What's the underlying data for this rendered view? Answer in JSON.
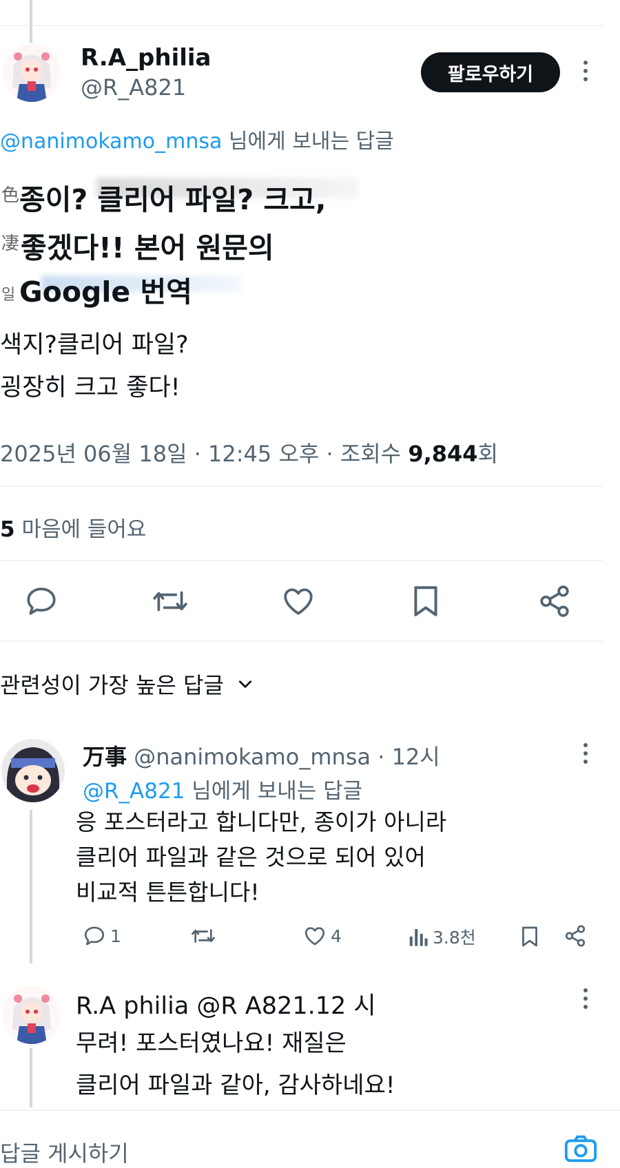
{
  "tweet": {
    "display_name": "R.A_philia",
    "handle": "@R_A821",
    "follow_label": "팔로우하기",
    "reply_to_handle": "@nanimokamo_mnsa",
    "reply_to_suffix": "님에게 보내는 답글",
    "translation_lines": [
      "종이? 클리어 파일? 크고,",
      "좋겠다!! 본어 원문의",
      "Google 번역"
    ],
    "ghost_glyphs": [
      "色",
      "凄",
      "일"
    ],
    "body_lines": [
      "색지?클리어 파일?",
      "굉장히 크고 좋다!"
    ],
    "meta_prefix": "2025년 06월 18일 · 12:45 오후 · 조회수 ",
    "views": "9,844",
    "views_suffix": "회",
    "likes_count": "5",
    "likes_label": "마음에 들어요"
  },
  "replies_sort": {
    "label": "관련성이 가장 높은 답글"
  },
  "reply1": {
    "display_name": "万事",
    "handle_time": "@nanimokamo_mnsa · 12시",
    "reply_to_handle": "@R_A821",
    "reply_to_suffix": "님에게 보내는 답글",
    "lines": [
      "응 포스터라고 합니다만, 종이가 아니라",
      "클리어 파일과 같은 것으로 되어 있어",
      "비교적 튼튼합니다!"
    ],
    "reply_count": "1",
    "like_count": "4",
    "view_count": "3.8천"
  },
  "reply2": {
    "header": "R.A philia @R A821.12 시",
    "lines": [
      "무려! 포스터였나요! 재질은",
      "클리어 파일과 같아, 감사하네요!"
    ]
  },
  "composer": {
    "placeholder": "답글 게시하기"
  },
  "icons": {
    "reply": "speech-bubble-icon",
    "retweet": "retweet-icon",
    "like": "heart-icon",
    "bookmark": "bookmark-icon",
    "share": "share-icon",
    "views": "bar-chart-icon",
    "more": "kebab-icon",
    "camera": "camera-icon"
  },
  "colors": {
    "follow_bg": "#0f1419",
    "link": "#1d9bf0",
    "secondary_text": "#536471",
    "divider": "#eff3f4"
  }
}
